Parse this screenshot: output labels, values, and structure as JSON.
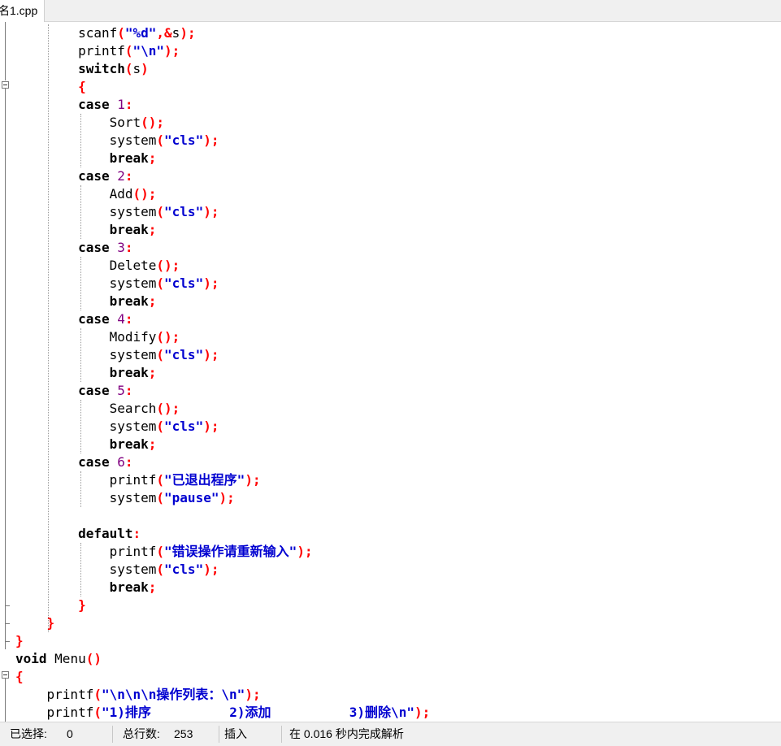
{
  "tab": {
    "title": "名1.cpp"
  },
  "code_lines": [
    [
      {
        "t": "        "
      },
      {
        "t": "scanf",
        "c": "id"
      },
      {
        "t": "(",
        "c": "sym"
      },
      {
        "t": "\"%d\"",
        "c": "str"
      },
      {
        "t": ",&",
        "c": "sym"
      },
      {
        "t": "s",
        "c": "id"
      },
      {
        "t": ");",
        "c": "sym"
      }
    ],
    [
      {
        "t": "        "
      },
      {
        "t": "printf",
        "c": "id"
      },
      {
        "t": "(",
        "c": "sym"
      },
      {
        "t": "\"\\n\"",
        "c": "str"
      },
      {
        "t": ");",
        "c": "sym"
      }
    ],
    [
      {
        "t": "        "
      },
      {
        "t": "switch",
        "c": "kw"
      },
      {
        "t": "(",
        "c": "sym"
      },
      {
        "t": "s",
        "c": "id"
      },
      {
        "t": ")",
        "c": "sym"
      }
    ],
    [
      {
        "t": "        "
      },
      {
        "t": "{",
        "c": "sym"
      }
    ],
    [
      {
        "t": "        "
      },
      {
        "t": "case",
        "c": "kw"
      },
      {
        "t": " "
      },
      {
        "t": "1",
        "c": "num"
      },
      {
        "t": ":",
        "c": "sym"
      }
    ],
    [
      {
        "t": "            "
      },
      {
        "t": "Sort",
        "c": "id"
      },
      {
        "t": "();",
        "c": "sym"
      }
    ],
    [
      {
        "t": "            "
      },
      {
        "t": "system",
        "c": "id"
      },
      {
        "t": "(",
        "c": "sym"
      },
      {
        "t": "\"cls\"",
        "c": "str"
      },
      {
        "t": ");",
        "c": "sym"
      }
    ],
    [
      {
        "t": "            "
      },
      {
        "t": "break",
        "c": "kw"
      },
      {
        "t": ";",
        "c": "sym"
      }
    ],
    [
      {
        "t": "        "
      },
      {
        "t": "case",
        "c": "kw"
      },
      {
        "t": " "
      },
      {
        "t": "2",
        "c": "num"
      },
      {
        "t": ":",
        "c": "sym"
      }
    ],
    [
      {
        "t": "            "
      },
      {
        "t": "Add",
        "c": "id"
      },
      {
        "t": "();",
        "c": "sym"
      }
    ],
    [
      {
        "t": "            "
      },
      {
        "t": "system",
        "c": "id"
      },
      {
        "t": "(",
        "c": "sym"
      },
      {
        "t": "\"cls\"",
        "c": "str"
      },
      {
        "t": ");",
        "c": "sym"
      }
    ],
    [
      {
        "t": "            "
      },
      {
        "t": "break",
        "c": "kw"
      },
      {
        "t": ";",
        "c": "sym"
      }
    ],
    [
      {
        "t": "        "
      },
      {
        "t": "case",
        "c": "kw"
      },
      {
        "t": " "
      },
      {
        "t": "3",
        "c": "num"
      },
      {
        "t": ":",
        "c": "sym"
      }
    ],
    [
      {
        "t": "            "
      },
      {
        "t": "Delete",
        "c": "id"
      },
      {
        "t": "();",
        "c": "sym"
      }
    ],
    [
      {
        "t": "            "
      },
      {
        "t": "system",
        "c": "id"
      },
      {
        "t": "(",
        "c": "sym"
      },
      {
        "t": "\"cls\"",
        "c": "str"
      },
      {
        "t": ");",
        "c": "sym"
      }
    ],
    [
      {
        "t": "            "
      },
      {
        "t": "break",
        "c": "kw"
      },
      {
        "t": ";",
        "c": "sym"
      }
    ],
    [
      {
        "t": "        "
      },
      {
        "t": "case",
        "c": "kw"
      },
      {
        "t": " "
      },
      {
        "t": "4",
        "c": "num"
      },
      {
        "t": ":",
        "c": "sym"
      }
    ],
    [
      {
        "t": "            "
      },
      {
        "t": "Modify",
        "c": "id"
      },
      {
        "t": "();",
        "c": "sym"
      }
    ],
    [
      {
        "t": "            "
      },
      {
        "t": "system",
        "c": "id"
      },
      {
        "t": "(",
        "c": "sym"
      },
      {
        "t": "\"cls\"",
        "c": "str"
      },
      {
        "t": ");",
        "c": "sym"
      }
    ],
    [
      {
        "t": "            "
      },
      {
        "t": "break",
        "c": "kw"
      },
      {
        "t": ";",
        "c": "sym"
      }
    ],
    [
      {
        "t": "        "
      },
      {
        "t": "case",
        "c": "kw"
      },
      {
        "t": " "
      },
      {
        "t": "5",
        "c": "num"
      },
      {
        "t": ":",
        "c": "sym"
      }
    ],
    [
      {
        "t": "            "
      },
      {
        "t": "Search",
        "c": "id"
      },
      {
        "t": "();",
        "c": "sym"
      }
    ],
    [
      {
        "t": "            "
      },
      {
        "t": "system",
        "c": "id"
      },
      {
        "t": "(",
        "c": "sym"
      },
      {
        "t": "\"cls\"",
        "c": "str"
      },
      {
        "t": ");",
        "c": "sym"
      }
    ],
    [
      {
        "t": "            "
      },
      {
        "t": "break",
        "c": "kw"
      },
      {
        "t": ";",
        "c": "sym"
      }
    ],
    [
      {
        "t": "        "
      },
      {
        "t": "case",
        "c": "kw"
      },
      {
        "t": " "
      },
      {
        "t": "6",
        "c": "num"
      },
      {
        "t": ":",
        "c": "sym"
      }
    ],
    [
      {
        "t": "            "
      },
      {
        "t": "printf",
        "c": "id"
      },
      {
        "t": "(",
        "c": "sym"
      },
      {
        "t": "\"已退出程序\"",
        "c": "str"
      },
      {
        "t": ");",
        "c": "sym"
      }
    ],
    [
      {
        "t": "            "
      },
      {
        "t": "system",
        "c": "id"
      },
      {
        "t": "(",
        "c": "sym"
      },
      {
        "t": "\"pause\"",
        "c": "str"
      },
      {
        "t": ");",
        "c": "sym"
      }
    ],
    [],
    [
      {
        "t": "        "
      },
      {
        "t": "default",
        "c": "kw"
      },
      {
        "t": ":",
        "c": "sym"
      }
    ],
    [
      {
        "t": "            "
      },
      {
        "t": "printf",
        "c": "id"
      },
      {
        "t": "(",
        "c": "sym"
      },
      {
        "t": "\"错误操作请重新输入\"",
        "c": "str"
      },
      {
        "t": ");",
        "c": "sym"
      }
    ],
    [
      {
        "t": "            "
      },
      {
        "t": "system",
        "c": "id"
      },
      {
        "t": "(",
        "c": "sym"
      },
      {
        "t": "\"cls\"",
        "c": "str"
      },
      {
        "t": ");",
        "c": "sym"
      }
    ],
    [
      {
        "t": "            "
      },
      {
        "t": "break",
        "c": "kw"
      },
      {
        "t": ";",
        "c": "sym"
      }
    ],
    [
      {
        "t": "        "
      },
      {
        "t": "}",
        "c": "sym"
      }
    ],
    [
      {
        "t": "    "
      },
      {
        "t": "}",
        "c": "sym"
      }
    ],
    [
      {
        "t": "}",
        "c": "sym"
      }
    ],
    [
      {
        "t": "void",
        "c": "kw"
      },
      {
        "t": " "
      },
      {
        "t": "Menu",
        "c": "id"
      },
      {
        "t": "()",
        "c": "sym"
      }
    ],
    [
      {
        "t": "{",
        "c": "sym"
      }
    ],
    [
      {
        "t": "    "
      },
      {
        "t": "printf",
        "c": "id"
      },
      {
        "t": "(",
        "c": "sym"
      },
      {
        "t": "\"\\n\\n\\n操作列表：\\n\"",
        "c": "str"
      },
      {
        "t": ");",
        "c": "sym"
      }
    ],
    [
      {
        "t": "    "
      },
      {
        "t": "printf",
        "c": "id"
      },
      {
        "t": "(",
        "c": "sym"
      },
      {
        "t": "\"1)排序          2)添加          3)删除\\n\"",
        "c": "str"
      },
      {
        "t": ");",
        "c": "sym"
      }
    ]
  ],
  "status": {
    "selected_label": "已选择:",
    "selected_value": "0",
    "lines_label": "总行数:",
    "lines_value": "253",
    "mode": "插入",
    "parse_info": "在 0.016 秒内完成解析"
  },
  "colors": {
    "keyword": "#000000",
    "number": "#800080",
    "string": "#0000d0",
    "symbol": "#ff0000",
    "background": "#ffffff",
    "chrome": "#f0f0f0"
  }
}
